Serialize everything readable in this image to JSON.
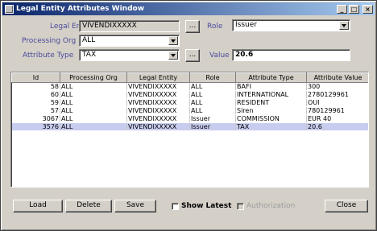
{
  "window": {
    "title": "Legal Entity Attributes Window"
  },
  "titlebar": {
    "minimize": "_",
    "maximize": "□",
    "close": "×"
  },
  "form": {
    "legal_entity_label": "Legal Entity",
    "legal_entity_value": "VIVENDIXXXXX",
    "legal_entity_picker": "...",
    "role_label": "Role",
    "role_value": "Issuer",
    "processing_org_label": "Processing Org",
    "processing_org_value": "ALL",
    "attribute_type_label": "Attribute Type",
    "attribute_type_value": "TAX",
    "attribute_type_picker": "...",
    "value_label": "Value",
    "value_value": "20.6"
  },
  "table": {
    "columns": [
      "Id",
      "Processing Org",
      "Legal Entity",
      "Role",
      "Attribute Type",
      "Attribute Value"
    ],
    "rows": [
      {
        "id": "58",
        "org": "ALL",
        "entity": "VIVENDIXXXXX",
        "role": "ALL",
        "type": "BAFI",
        "value": "300"
      },
      {
        "id": "60",
        "org": "ALL",
        "entity": "VIVENDIXXXXX",
        "role": "ALL",
        "type": "INTERNATIONAL",
        "value": "2780129961"
      },
      {
        "id": "59",
        "org": "ALL",
        "entity": "VIVENDIXXXXX",
        "role": "ALL",
        "type": "RESIDENT",
        "value": "OUI"
      },
      {
        "id": "57",
        "org": "ALL",
        "entity": "VIVENDIXXXXX",
        "role": "ALL",
        "type": "Siren",
        "value": "780129961"
      },
      {
        "id": "3067",
        "org": "ALL",
        "entity": "VIVENDIXXXXX",
        "role": "Issuer",
        "type": "COMMISSION",
        "value": "EUR 40"
      },
      {
        "id": "3576",
        "org": "ALL",
        "entity": "VIVENDIXXXXX",
        "role": "Issuer",
        "type": "TAX",
        "value": "20.6"
      }
    ],
    "selected_row": 5
  },
  "buttons": {
    "load": "Load",
    "delete": "Delete",
    "save": "Save",
    "show_latest": "Show Latest",
    "authorization": "Authorization",
    "close": "Close"
  },
  "colors": {
    "title_gradient_start": "#0a246a",
    "label_color": "#4a4a9c",
    "selected_row": "#c8ccee"
  }
}
